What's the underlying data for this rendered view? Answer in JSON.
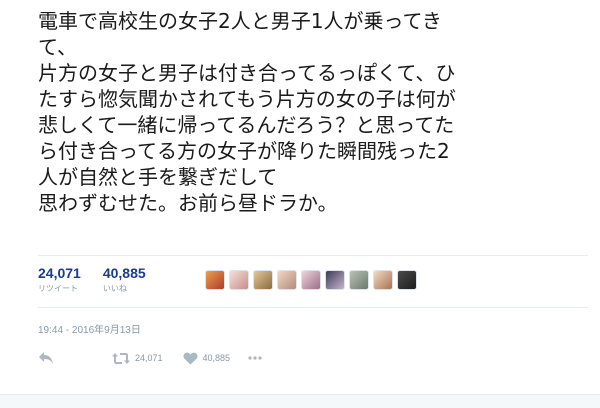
{
  "tweet": {
    "lines": [
      "電車で高校生の女子2人と男子1人が乗ってき",
      "て、",
      "片方の女子と男子は付き合ってるっぽくて、ひ",
      "たすら惚気聞かされてもう片方の女の子は何が",
      "悲しくて一緒に帰ってるんだろう？と思ってた",
      "ら付き合ってる方の女子が降りた瞬間残った2",
      "人が自然と手を繋ぎだして",
      "思わずむせた。お前ら昼ドラか。"
    ]
  },
  "stats": {
    "retweets": {
      "count": "24,071",
      "label": "リツイート"
    },
    "likes": {
      "count": "40,885",
      "label": "いいね"
    }
  },
  "avatars": [
    {
      "icon": "avatar-1"
    },
    {
      "icon": "avatar-2"
    },
    {
      "icon": "avatar-3"
    },
    {
      "icon": "avatar-4"
    },
    {
      "icon": "avatar-5"
    },
    {
      "icon": "avatar-6"
    },
    {
      "icon": "avatar-7"
    },
    {
      "icon": "avatar-8"
    },
    {
      "icon": "avatar-9"
    }
  ],
  "timestamp": "19:44 - 2016年9月13日",
  "actions": {
    "reply": {
      "icon": "reply-icon"
    },
    "retweet": {
      "icon": "retweet-icon",
      "count": "24,071"
    },
    "like": {
      "icon": "heart-icon",
      "count": "40,885"
    },
    "more": {
      "icon": "more-icon"
    }
  },
  "colors": {
    "stat_number": "#1b3c8c",
    "secondary_text": "#8899a6",
    "action_icon": "#aab8c2",
    "divider": "#e6ecf0"
  }
}
